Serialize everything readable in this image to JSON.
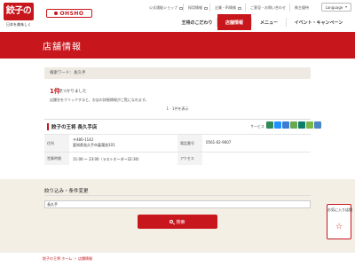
{
  "logo": {
    "text": "餃子の王将",
    "tagline": "日本を美味しく"
  },
  "brand_sub": {
    "text": "OHSHO"
  },
  "utility_links": [
    {
      "label": "公式通販ショップ"
    },
    {
      "label": "採用情報"
    },
    {
      "label": "企業・IR情報"
    },
    {
      "label": "ご意見・お問い合わせ"
    },
    {
      "label": "株主優待"
    }
  ],
  "language": {
    "label": "Language"
  },
  "nav": [
    {
      "label": "王将のこだわり"
    },
    {
      "label": "店舗情報"
    },
    {
      "label": "メニュー"
    },
    {
      "label": "イベント・キャンペーン"
    }
  ],
  "page_title": "店舗情報",
  "search_keyword_line": "検索ワード：長久手",
  "result": {
    "count": "1件",
    "suffix": "見つかりました",
    "hint": "店舗名をクリックすると、お店の詳細情報がご覧になれます。",
    "pager": "1 - 1件を表示"
  },
  "store": {
    "name": "餃子の王将 長久手店",
    "service_label": "サービス",
    "service_icon_colors": [
      "#2e8b57",
      "#1e90ff",
      "#3b7bd4",
      "#6aa84f",
      "#0e7d6b",
      "#7ab648",
      "#4a86c5"
    ],
    "address_label": "住所",
    "address_zip": "〒480-1142",
    "address_line": "愛知県長久手市菖蒲池101",
    "phone_label": "電話番号",
    "phone": "0561-62-9607",
    "hours_label": "営業時間",
    "hours": "11:00 ～ 23:00（ラストオーダー22:30）",
    "access_label": "アクセス",
    "access": ""
  },
  "filter": {
    "title": "絞り込み・条件変更",
    "input_value": "長久手",
    "button_label": "検索"
  },
  "favorite": {
    "label": "お気に入り店舗"
  },
  "breadcrumb": [
    {
      "label": "餃子の王将 ホーム"
    },
    {
      "label": "店舗情報"
    }
  ],
  "colors": {
    "brand_red": "#c8161d",
    "cream": "#f3efe5"
  }
}
